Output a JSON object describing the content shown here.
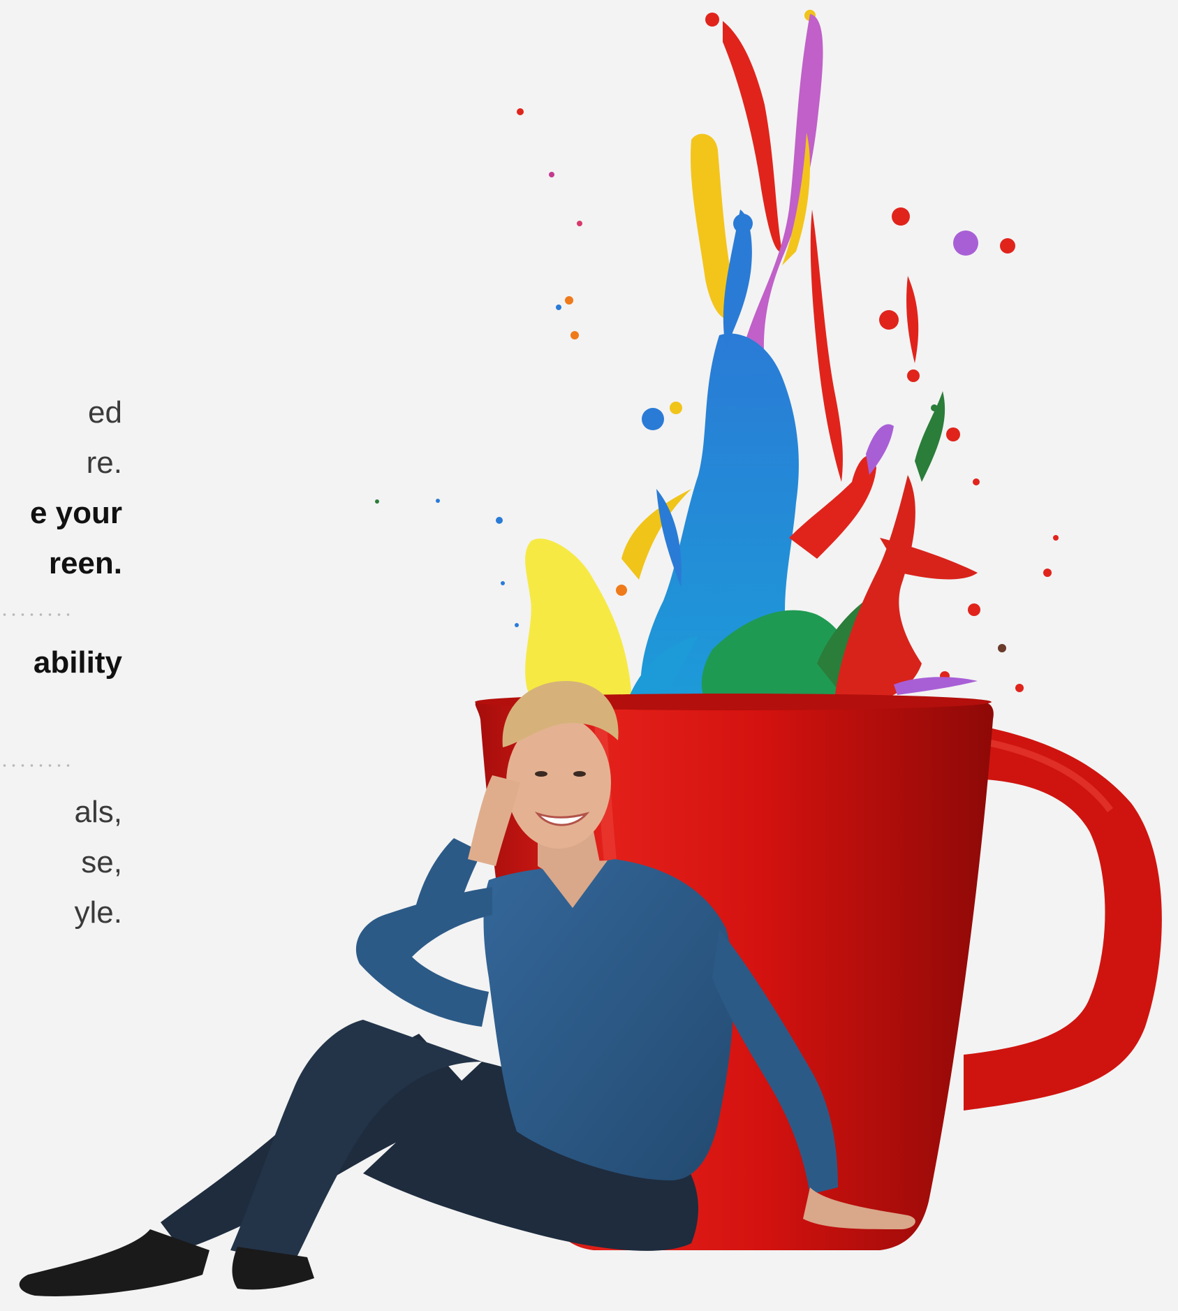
{
  "copy": {
    "line1": "ed",
    "line2": "re.",
    "line3": "e your",
    "line4": "reen.",
    "line5": "ability",
    "line6": "als,",
    "line7": "se,",
    "line8": "yle."
  },
  "colors": {
    "background": "#f3f3f3",
    "mug": "#d4120f",
    "sweater": "#2f5b86",
    "jeans": "#1e2c3e"
  },
  "illustration": {
    "subject": "woman-sitting-by-mug",
    "paint": "paint-splash",
    "mug": "red-mug"
  }
}
